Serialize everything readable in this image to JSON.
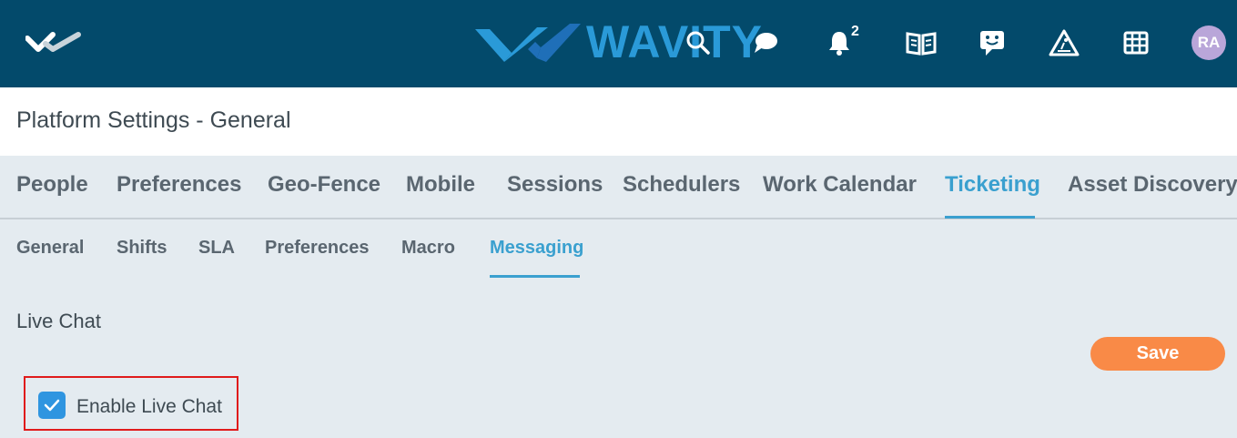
{
  "header": {
    "brand": "WAVITY",
    "notification_count": "2",
    "avatar_initials": "RA",
    "icons": [
      "home-logo-icon",
      "search-icon",
      "chat-icon",
      "bell-icon",
      "book-icon",
      "feedback-icon",
      "construction-icon",
      "apps-grid-icon"
    ]
  },
  "page": {
    "title": "Platform Settings - General"
  },
  "main_tabs": [
    "People",
    "Preferences",
    "Geo-Fence",
    "Mobile",
    "Sessions",
    "Schedulers",
    "Work Calendar",
    "Ticketing",
    "Asset Discovery"
  ],
  "main_tabs_active": "Ticketing",
  "sub_tabs": [
    "General",
    "Shifts",
    "SLA",
    "Preferences",
    "Macro",
    "Messaging"
  ],
  "sub_tabs_active": "Messaging",
  "content": {
    "section_title": "Live Chat",
    "save_label": "Save",
    "enable_live_chat_label": "Enable Live Chat",
    "enable_live_chat_checked": true
  },
  "colors": {
    "topbar": "#034a6b",
    "accent": "#3aa0cf",
    "save": "#f98a47",
    "checkbox": "#2f95e0",
    "highlight": "#e01b1b",
    "avatar": "#b9a6d9"
  }
}
